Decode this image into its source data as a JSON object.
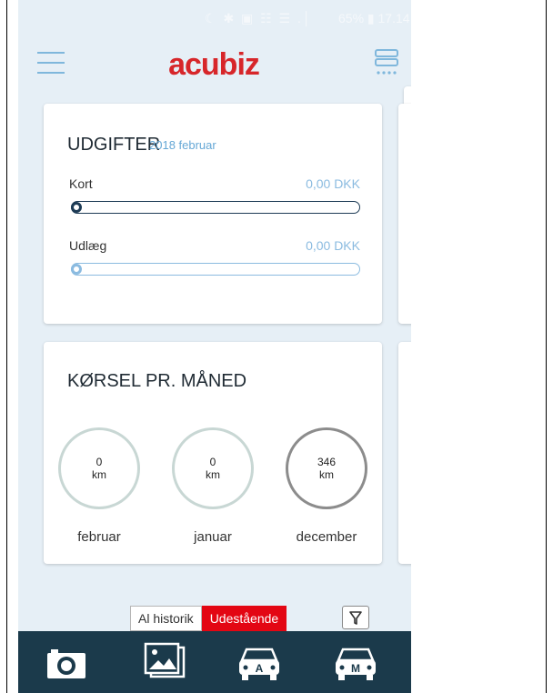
{
  "statusbar": {
    "icons": "☾ ✱ ▣ ☷ ☰ .│",
    "battery": "65% ▮ 17.14"
  },
  "appbar": {
    "logo": "acubiz"
  },
  "expenses": {
    "title": "UDGIFTER",
    "period": "2018 februar",
    "rows": [
      {
        "label": "Kort",
        "amount": "0,00 DKK",
        "progress": 0
      },
      {
        "label": "Udlæg",
        "amount": "0,00 DKK",
        "progress": 0
      }
    ]
  },
  "mileage": {
    "title": "KØRSEL PR. MÅNED",
    "months": [
      {
        "value": "0",
        "unit": "km",
        "month": "februar"
      },
      {
        "value": "0",
        "unit": "km",
        "month": "januar"
      },
      {
        "value": "346",
        "unit": "km",
        "month": "december"
      }
    ]
  },
  "tabs": {
    "all_history": "Al historik",
    "outstanding": "Udestående"
  },
  "bottombar": {
    "items": [
      {
        "name": "camera-icon"
      },
      {
        "name": "gallery-icon"
      },
      {
        "name": "car-auto-icon",
        "letter": "A"
      },
      {
        "name": "car-manual-icon",
        "letter": "M"
      }
    ]
  },
  "colors": {
    "brand": "#d7262a",
    "accent": "#66a8d6",
    "active_tab": "#e30613",
    "bottombar": "#1b3a4b",
    "background": "#e6eff6"
  }
}
